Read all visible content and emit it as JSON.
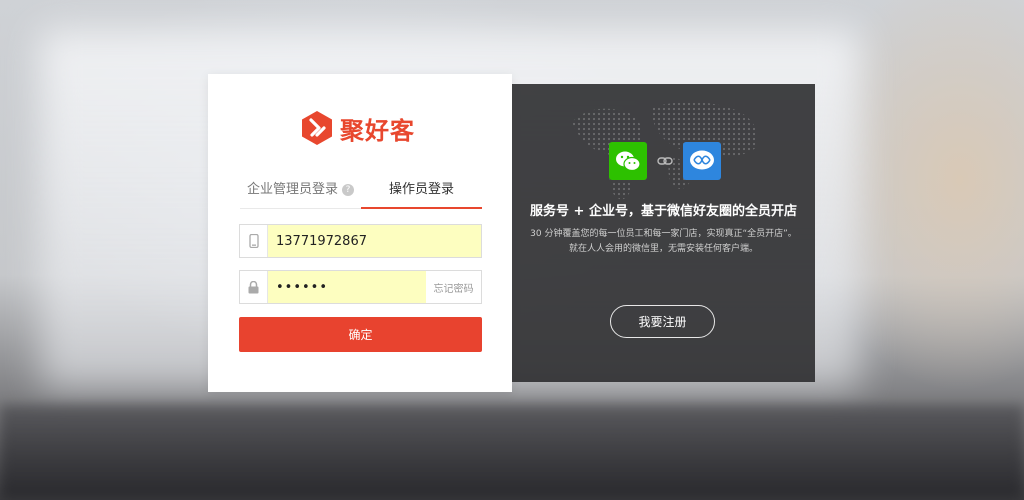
{
  "brand": {
    "name": "聚好客",
    "color": "#e8472e"
  },
  "login": {
    "tabs": [
      {
        "label": "企业管理员登录",
        "help_icon": "question-circle-icon"
      },
      {
        "label": "操作员登录",
        "active": true
      }
    ],
    "phone_value": "13771972867",
    "password_value": "••••••",
    "forgot_label": "忘记密码",
    "submit_label": "确定",
    "submit_color": "#e8432f"
  },
  "promo": {
    "icons": [
      "wechat-icon",
      "link-icon",
      "wechat-work-icon"
    ],
    "slogan": "服务号 + 企业号，基于微信好友圈的全员开店",
    "desc_line1": "30 分钟覆盖您的每一位员工和每一家门店，实现真正“全员开店”。",
    "desc_line2": "就在人人会用的微信里，无需安装任何客户端。",
    "register_label": "我要注册"
  }
}
